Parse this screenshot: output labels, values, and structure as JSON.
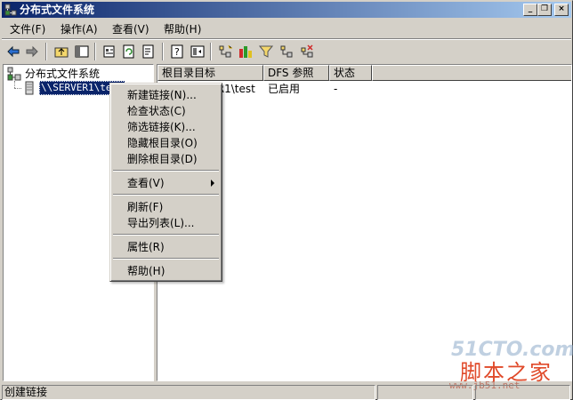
{
  "window": {
    "title": "分布式文件系统",
    "controls": {
      "minimize": "_",
      "restore": "❐",
      "close": "×"
    }
  },
  "menubar": [
    {
      "label": "文件(F)"
    },
    {
      "label": "操作(A)"
    },
    {
      "label": "查看(V)"
    },
    {
      "label": "帮助(H)"
    }
  ],
  "toolbar_icons": [
    "back-icon",
    "forward-icon",
    "up-folder-icon",
    "show-tree-icon",
    "properties-icon",
    "refresh-icon",
    "export-icon",
    "help-icon",
    "console-icon",
    "new-root-icon",
    "filter-icon",
    "check-status-icon",
    "delete-icon"
  ],
  "tree": {
    "root": "分布式文件系统",
    "child": "\\\\SERVER1\\test"
  },
  "table": {
    "columns": [
      "根目录目标",
      "DFS 参照",
      "状态"
    ],
    "rows": [
      {
        "target": "\\\\SERVER1\\test",
        "referral": "已启用",
        "status": "-"
      }
    ]
  },
  "context_menu": {
    "items": [
      {
        "label": "新建链接(N)..."
      },
      {
        "label": "检查状态(C)"
      },
      {
        "label": "筛选链接(K)..."
      },
      {
        "label": "隐藏根目录(O)"
      },
      {
        "label": "删除根目录(D)"
      },
      {
        "label": "查看(V)",
        "submenu": true
      },
      {
        "label": "刷新(F)"
      },
      {
        "label": "导出列表(L)..."
      },
      {
        "label": "属性(R)"
      },
      {
        "label": "帮助(H)"
      }
    ]
  },
  "statusbar": {
    "text": "创建链接"
  },
  "watermark": {
    "site": "51CTO.com",
    "name": "脚本之家",
    "url": "www.jb51.net"
  },
  "colors": {
    "title_start": "#0a246a",
    "title_end": "#a6caf0",
    "selection": "#0a246a",
    "face": "#d4d0c8"
  }
}
